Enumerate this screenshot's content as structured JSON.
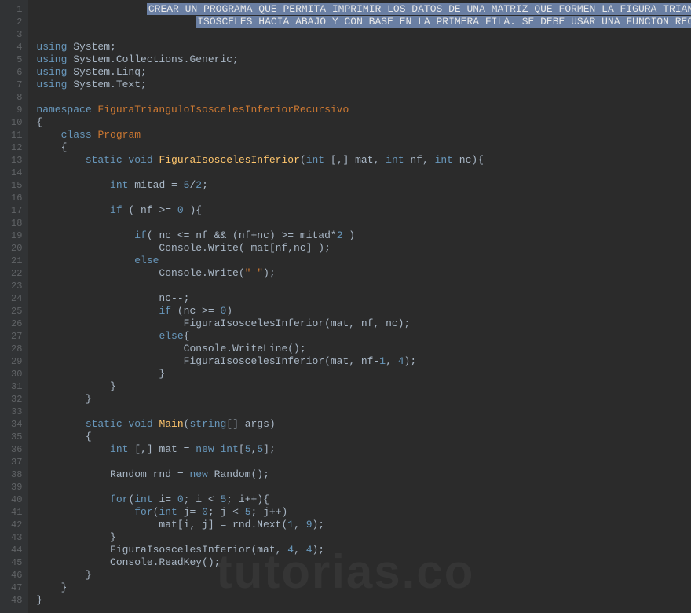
{
  "watermark": "tutorias.co",
  "lines": [
    {
      "n": 1,
      "sel": "CREAR UN PROGRAMA QUE PERMITA IMPRIMIR LOS DATOS DE UNA MATRIZ QUE FORMEN LA FIGURA TRIANGULO",
      "indent": 18
    },
    {
      "n": 2,
      "sel": "ISOSCELES HACIA ABAJO Y CON BASE EN LA PRIMERA FILA. SE DEBE USAR UNA FUNCION RECURSIVA",
      "indent": 26
    },
    {
      "n": 3,
      "t": []
    },
    {
      "n": 4,
      "t": [
        [
          "blue",
          "using "
        ],
        [
          "gray",
          "System;"
        ]
      ]
    },
    {
      "n": 5,
      "t": [
        [
          "blue",
          "using "
        ],
        [
          "gray",
          "System.Collections.Generic;"
        ]
      ]
    },
    {
      "n": 6,
      "t": [
        [
          "blue",
          "using "
        ],
        [
          "gray",
          "System.Linq;"
        ]
      ]
    },
    {
      "n": 7,
      "t": [
        [
          "blue",
          "using "
        ],
        [
          "gray",
          "System.Text;"
        ]
      ]
    },
    {
      "n": 8,
      "t": []
    },
    {
      "n": 9,
      "t": [
        [
          "blue",
          "namespace "
        ],
        [
          "orange",
          "FiguraTrianguloIsoscelesInferiorRecursivo"
        ]
      ]
    },
    {
      "n": 10,
      "t": [
        [
          "gray",
          "{"
        ]
      ]
    },
    {
      "n": 11,
      "t": [
        [
          "gray",
          "    "
        ],
        [
          "blue",
          "class "
        ],
        [
          "orange",
          "Program"
        ]
      ]
    },
    {
      "n": 12,
      "t": [
        [
          "gray",
          "    {"
        ]
      ]
    },
    {
      "n": 13,
      "t": [
        [
          "gray",
          "        "
        ],
        [
          "blue",
          "static void "
        ],
        [
          "yellow",
          "FiguraIsoscelesInferior"
        ],
        [
          "gray",
          "("
        ],
        [
          "blue",
          "int "
        ],
        [
          "gray",
          "[,] mat, "
        ],
        [
          "blue",
          "int "
        ],
        [
          "gray",
          "nf, "
        ],
        [
          "blue",
          "int "
        ],
        [
          "gray",
          "nc){"
        ]
      ]
    },
    {
      "n": 14,
      "t": []
    },
    {
      "n": 15,
      "t": [
        [
          "gray",
          "            "
        ],
        [
          "blue",
          "int "
        ],
        [
          "gray",
          "mitad = "
        ],
        [
          "blue",
          "5"
        ],
        [
          "gray",
          "/"
        ],
        [
          "blue",
          "2"
        ],
        [
          "gray",
          ";"
        ]
      ]
    },
    {
      "n": 16,
      "t": []
    },
    {
      "n": 17,
      "t": [
        [
          "gray",
          "            "
        ],
        [
          "blue",
          "if "
        ],
        [
          "gray",
          "( nf >= "
        ],
        [
          "blue",
          "0 "
        ],
        [
          "gray",
          "){"
        ]
      ]
    },
    {
      "n": 18,
      "t": []
    },
    {
      "n": 19,
      "t": [
        [
          "gray",
          "                "
        ],
        [
          "blue",
          "if"
        ],
        [
          "gray",
          "( nc <= nf && (nf+nc) >= mitad*"
        ],
        [
          "blue",
          "2 "
        ],
        [
          "gray",
          ")"
        ]
      ]
    },
    {
      "n": 20,
      "t": [
        [
          "gray",
          "                    Console.Write( mat[nf,nc] );"
        ]
      ]
    },
    {
      "n": 21,
      "t": [
        [
          "gray",
          "                "
        ],
        [
          "blue",
          "else"
        ]
      ]
    },
    {
      "n": 22,
      "t": [
        [
          "gray",
          "                    Console.Write("
        ],
        [
          "orange",
          "\"-\""
        ],
        [
          "gray",
          ");"
        ]
      ]
    },
    {
      "n": 23,
      "t": []
    },
    {
      "n": 24,
      "t": [
        [
          "gray",
          "                    nc--;"
        ]
      ]
    },
    {
      "n": 25,
      "t": [
        [
          "gray",
          "                    "
        ],
        [
          "blue",
          "if "
        ],
        [
          "gray",
          "(nc >= "
        ],
        [
          "blue",
          "0"
        ],
        [
          "gray",
          ")"
        ]
      ]
    },
    {
      "n": 26,
      "t": [
        [
          "gray",
          "                        FiguraIsoscelesInferior(mat, nf, nc);"
        ]
      ]
    },
    {
      "n": 27,
      "t": [
        [
          "gray",
          "                    "
        ],
        [
          "blue",
          "else"
        ],
        [
          "gray",
          "{"
        ]
      ]
    },
    {
      "n": 28,
      "t": [
        [
          "gray",
          "                        Console.WriteLine();"
        ]
      ]
    },
    {
      "n": 29,
      "t": [
        [
          "gray",
          "                        FiguraIsoscelesInferior(mat, nf-"
        ],
        [
          "blue",
          "1"
        ],
        [
          "gray",
          ", "
        ],
        [
          "blue",
          "4"
        ],
        [
          "gray",
          ");"
        ]
      ]
    },
    {
      "n": 30,
      "t": [
        [
          "gray",
          "                    }"
        ]
      ]
    },
    {
      "n": 31,
      "t": [
        [
          "gray",
          "            }"
        ]
      ]
    },
    {
      "n": 32,
      "t": [
        [
          "gray",
          "        }"
        ]
      ]
    },
    {
      "n": 33,
      "t": []
    },
    {
      "n": 34,
      "t": [
        [
          "gray",
          "        "
        ],
        [
          "blue",
          "static void "
        ],
        [
          "yellow",
          "Main"
        ],
        [
          "gray",
          "("
        ],
        [
          "blue",
          "string"
        ],
        [
          "gray",
          "[] args)"
        ]
      ]
    },
    {
      "n": 35,
      "t": [
        [
          "gray",
          "        {"
        ]
      ]
    },
    {
      "n": 36,
      "t": [
        [
          "gray",
          "            "
        ],
        [
          "blue",
          "int "
        ],
        [
          "gray",
          "[,] mat = "
        ],
        [
          "blue",
          "new int"
        ],
        [
          "gray",
          "["
        ],
        [
          "blue",
          "5"
        ],
        [
          "gray",
          ","
        ],
        [
          "blue",
          "5"
        ],
        [
          "gray",
          "];"
        ]
      ]
    },
    {
      "n": 37,
      "t": []
    },
    {
      "n": 38,
      "t": [
        [
          "gray",
          "            Random rnd = "
        ],
        [
          "blue",
          "new "
        ],
        [
          "gray",
          "Random();"
        ]
      ]
    },
    {
      "n": 39,
      "t": []
    },
    {
      "n": 40,
      "t": [
        [
          "gray",
          "            "
        ],
        [
          "blue",
          "for"
        ],
        [
          "gray",
          "("
        ],
        [
          "blue",
          "int "
        ],
        [
          "gray",
          "i= "
        ],
        [
          "blue",
          "0"
        ],
        [
          "gray",
          "; i < "
        ],
        [
          "blue",
          "5"
        ],
        [
          "gray",
          "; i++){"
        ]
      ]
    },
    {
      "n": 41,
      "t": [
        [
          "gray",
          "                "
        ],
        [
          "blue",
          "for"
        ],
        [
          "gray",
          "("
        ],
        [
          "blue",
          "int "
        ],
        [
          "gray",
          "j= "
        ],
        [
          "blue",
          "0"
        ],
        [
          "gray",
          "; j < "
        ],
        [
          "blue",
          "5"
        ],
        [
          "gray",
          "; j++)"
        ]
      ]
    },
    {
      "n": 42,
      "t": [
        [
          "gray",
          "                    mat[i, j] = rnd.Next("
        ],
        [
          "blue",
          "1"
        ],
        [
          "gray",
          ", "
        ],
        [
          "blue",
          "9"
        ],
        [
          "gray",
          ");"
        ]
      ]
    },
    {
      "n": 43,
      "t": [
        [
          "gray",
          "            }"
        ]
      ]
    },
    {
      "n": 44,
      "t": [
        [
          "gray",
          "            FiguraIsoscelesInferior(mat, "
        ],
        [
          "blue",
          "4"
        ],
        [
          "gray",
          ", "
        ],
        [
          "blue",
          "4"
        ],
        [
          "gray",
          ");"
        ]
      ]
    },
    {
      "n": 45,
      "t": [
        [
          "gray",
          "            Console.ReadKey();"
        ]
      ]
    },
    {
      "n": 46,
      "t": [
        [
          "gray",
          "        }"
        ]
      ]
    },
    {
      "n": 47,
      "t": [
        [
          "gray",
          "    }"
        ]
      ]
    },
    {
      "n": 48,
      "t": [
        [
          "gray",
          "}"
        ]
      ]
    }
  ]
}
